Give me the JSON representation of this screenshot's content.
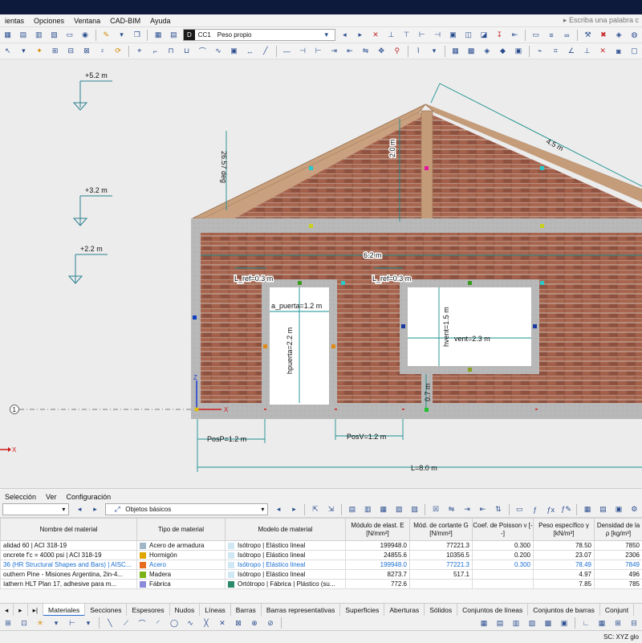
{
  "menu": {
    "items": [
      "ientas",
      "Opciones",
      "Ventana",
      "CAD-BIM",
      "Ayuda"
    ],
    "search_placeholder": "Escriba una palabra c"
  },
  "toolbar": {
    "load_case_badge": "D",
    "load_case_code": "CC1",
    "load_case_name": "Peso propio"
  },
  "canvas": {
    "dims": {
      "level_52": "+5.2 m",
      "level_32": "+3.2 m",
      "level_22": "+2.2 m",
      "angle": "26.57 deg",
      "roof_slope": "4.5 m",
      "ridge_height": "2.0 m",
      "width_62": "6.2 m",
      "lref_left": "L_ref=0.3 m",
      "lref_right": "L_ref=0.3 m",
      "a_puerta": "a_puerta=1.2 m",
      "hpuerta": "hpuerta=2.2 m",
      "hvent": "hvent=1.5 m",
      "vent": "vent=2.3 m",
      "sill": "0.7 m",
      "posP": "PosP=1.2 m",
      "posV": "PosV=1.2 m",
      "L": "L=8.0 m"
    },
    "axes": {
      "z": "Z",
      "x": "X",
      "gx": "X"
    },
    "line_number": "1"
  },
  "panel": {
    "menu": [
      "Selección",
      "Ver",
      "Configuración"
    ],
    "filter_label": "Objetos básicos",
    "columns": [
      "Nombre del material",
      "Tipo de material",
      "Modelo de material",
      "Módulo de elast. E [N/mm²]",
      "Mód. de cortante G [N/mm²]",
      "Coef. de Poisson ν [--]",
      "Peso específico γ [kN/m³]",
      "Densidad de la ρ [kg/m³]"
    ],
    "rows": [
      {
        "name": "alidad 60 | ACI 318-19",
        "type": "Acero de armadura",
        "type_color": "#9fb6c8",
        "model": "Isótropo | Elástico lineal",
        "E": "199948.0",
        "G": "77221.3",
        "nu": "0.300",
        "gamma": "78.50",
        "rho": "7850",
        "selected": false
      },
      {
        "name": "oncrete f'c = 4000 psi | ACI 318-19",
        "type": "Hormigón",
        "type_color": "#e0a500",
        "model": "Isótropo | Elástico lineal",
        "E": "24855.6",
        "G": "10356.5",
        "nu": "0.200",
        "gamma": "23.07",
        "rho": "2306",
        "selected": false
      },
      {
        "name": "36 (HR Structural Shapes and Bars) | AISC...",
        "type": "Acero",
        "type_color": "#e86b1f",
        "model": "Isótropo | Elástico lineal",
        "E": "199948.0",
        "G": "77221.3",
        "nu": "0.300",
        "gamma": "78.49",
        "rho": "7849",
        "selected": true
      },
      {
        "name": "outhern Pine - Misiones Argentina, 2in-4...",
        "type": "Madera",
        "type_color": "#7ab317",
        "model": "Isótropo | Elástico lineal",
        "E": "8273.7",
        "G": "517.1",
        "nu": "",
        "gamma": "4.97",
        "rho": "496",
        "selected": false
      },
      {
        "name": "Iathern HLT Plan 17, adhesive para m...",
        "type": "Fábrica",
        "type_color": "#8a8ad8",
        "model": "Ortótropo | Fábrica | Plástico (su...",
        "E": "772.6",
        "G": "",
        "nu": "",
        "gamma": "7.85",
        "rho": "785",
        "selected": false
      }
    ],
    "tabs": [
      "Materiales",
      "Secciones",
      "Espesores",
      "Nudos",
      "Líneas",
      "Barras",
      "Barras representativas",
      "Superficies",
      "Aberturas",
      "Sólidos",
      "Conjuntos de líneas",
      "Conjuntos de barras",
      "Conjunt"
    ],
    "status": "SC: XYZ glo"
  }
}
